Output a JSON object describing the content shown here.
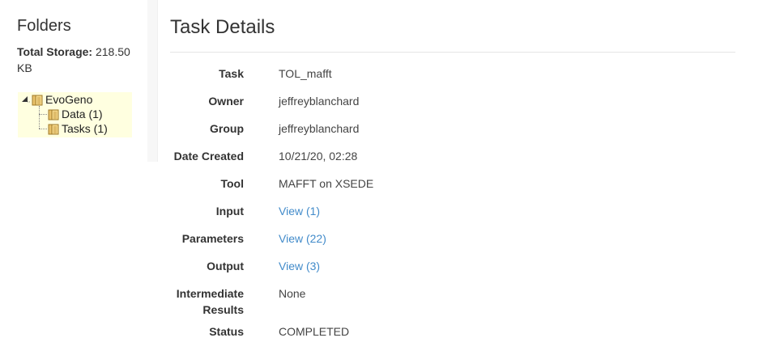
{
  "sidebar": {
    "title": "Folders",
    "storage_label": "Total Storage:",
    "storage_value": "218.50 KB",
    "tree": {
      "root": "EvoGeno",
      "children": [
        "Data (1)",
        "Tasks (1)"
      ]
    }
  },
  "main": {
    "title": "Task Details",
    "rows": [
      {
        "label": "Task",
        "value": "TOL_mafft"
      },
      {
        "label": "Owner",
        "value": "jeffreyblanchard"
      },
      {
        "label": "Group",
        "value": "jeffreyblanchard"
      },
      {
        "label": "Date Created",
        "value": "10/21/20, 02:28"
      },
      {
        "label": "Tool",
        "value": "MAFFT on XSEDE"
      },
      {
        "label": "Input",
        "value": "View (1)"
      },
      {
        "label": "Parameters",
        "value": "View (22)"
      },
      {
        "label": "Output",
        "value": "View (3)"
      },
      {
        "label": "Intermediate Results",
        "value": "None"
      },
      {
        "label": "Status",
        "value": "COMPLETED"
      }
    ]
  },
  "colors": {
    "link": "#428bca",
    "tree_highlight": "#ffffe0",
    "text": "#333333"
  }
}
